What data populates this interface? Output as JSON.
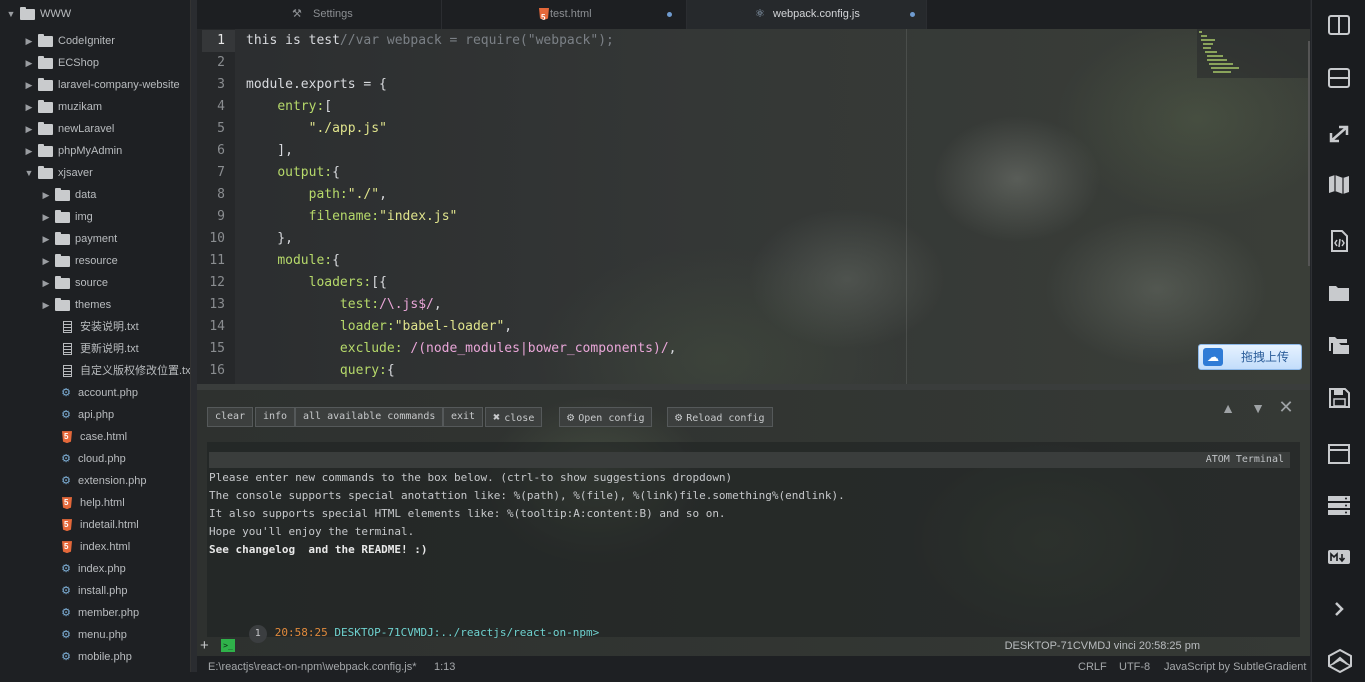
{
  "tree": {
    "root": "WWW",
    "items": [
      {
        "type": "folder",
        "label": "CodeIgniter",
        "depth": 1,
        "open": false
      },
      {
        "type": "folder",
        "label": "ECShop",
        "depth": 1,
        "open": false
      },
      {
        "type": "folder",
        "label": "laravel-company-website",
        "depth": 1,
        "open": false
      },
      {
        "type": "folder",
        "label": "muzikam",
        "depth": 1,
        "open": false
      },
      {
        "type": "folder",
        "label": "newLaravel",
        "depth": 1,
        "open": false
      },
      {
        "type": "folder",
        "label": "phpMyAdmin",
        "depth": 1,
        "open": false
      },
      {
        "type": "folder",
        "label": "xjsaver",
        "depth": 1,
        "open": true
      },
      {
        "type": "folder",
        "label": "data",
        "depth": 2,
        "open": false
      },
      {
        "type": "folder",
        "label": "img",
        "depth": 2,
        "open": false
      },
      {
        "type": "folder",
        "label": "payment",
        "depth": 2,
        "open": false
      },
      {
        "type": "folder",
        "label": "resource",
        "depth": 2,
        "open": false
      },
      {
        "type": "folder",
        "label": "source",
        "depth": 2,
        "open": false
      },
      {
        "type": "folder",
        "label": "themes",
        "depth": 2,
        "open": false
      },
      {
        "type": "txt",
        "label": "安装说明.txt",
        "depth": 2
      },
      {
        "type": "txt",
        "label": "更新说明.txt",
        "depth": 2
      },
      {
        "type": "txt",
        "label": "自定义版权修改位置.txt",
        "depth": 2
      },
      {
        "type": "php",
        "label": "account.php",
        "depth": 2
      },
      {
        "type": "php",
        "label": "api.php",
        "depth": 2
      },
      {
        "type": "html",
        "label": "case.html",
        "depth": 2
      },
      {
        "type": "php",
        "label": "cloud.php",
        "depth": 2
      },
      {
        "type": "php",
        "label": "extension.php",
        "depth": 2
      },
      {
        "type": "html",
        "label": "help.html",
        "depth": 2
      },
      {
        "type": "html",
        "label": "indetail.html",
        "depth": 2
      },
      {
        "type": "html",
        "label": "index.html",
        "depth": 2
      },
      {
        "type": "php",
        "label": "index.php",
        "depth": 2
      },
      {
        "type": "php",
        "label": "install.php",
        "depth": 2
      },
      {
        "type": "php",
        "label": "member.php",
        "depth": 2
      },
      {
        "type": "php",
        "label": "menu.php",
        "depth": 2
      },
      {
        "type": "php",
        "label": "mobile.php",
        "depth": 2
      }
    ]
  },
  "tabs": [
    {
      "label": "Settings",
      "icon": "tools-icon",
      "active": false,
      "modified": false
    },
    {
      "label": "test.html",
      "icon": "html5-icon",
      "active": false,
      "modified": true
    },
    {
      "label": "webpack.config.js",
      "icon": "atom-icon",
      "active": true,
      "modified": true
    }
  ],
  "editor": {
    "current_line": 1,
    "lines": [
      [
        [
          "pl",
          "this is test"
        ],
        [
          "cm",
          "//var webpack = require(\"webpack\");"
        ]
      ],
      [],
      [
        [
          "pl",
          "module.exports = {"
        ]
      ],
      [
        [
          "pl",
          "    "
        ],
        [
          "kw",
          "entry:"
        ],
        [
          "pl",
          "["
        ]
      ],
      [
        [
          "pl",
          "        "
        ],
        [
          "str",
          "\"./app.js\""
        ]
      ],
      [
        [
          "pl",
          "    ],"
        ]
      ],
      [
        [
          "pl",
          "    "
        ],
        [
          "kw",
          "output:"
        ],
        [
          "pl",
          "{"
        ]
      ],
      [
        [
          "pl",
          "        "
        ],
        [
          "kw",
          "path:"
        ],
        [
          "str",
          "\"./\""
        ],
        [
          "pl",
          ","
        ]
      ],
      [
        [
          "pl",
          "        "
        ],
        [
          "kw",
          "filename:"
        ],
        [
          "str",
          "\"index.js\""
        ]
      ],
      [
        [
          "pl",
          "    },"
        ]
      ],
      [
        [
          "pl",
          "    "
        ],
        [
          "kw",
          "module:"
        ],
        [
          "pl",
          "{"
        ]
      ],
      [
        [
          "pl",
          "        "
        ],
        [
          "kw",
          "loaders:"
        ],
        [
          "pl",
          "[{"
        ]
      ],
      [
        [
          "pl",
          "            "
        ],
        [
          "kw",
          "test:"
        ],
        [
          "rx",
          "/\\.js$/"
        ],
        [
          "pl",
          ","
        ]
      ],
      [
        [
          "pl",
          "            "
        ],
        [
          "kw",
          "loader:"
        ],
        [
          "str",
          "\"babel-loader\""
        ],
        [
          "pl",
          ","
        ]
      ],
      [
        [
          "pl",
          "            "
        ],
        [
          "kw",
          "exclude:"
        ],
        [
          "pl",
          " "
        ],
        [
          "rx",
          "/(node_modules|bower_components)/"
        ],
        [
          "pl",
          ","
        ]
      ],
      [
        [
          "pl",
          "            "
        ],
        [
          "kw",
          "query:"
        ],
        [
          "pl",
          "{"
        ]
      ]
    ]
  },
  "upload_button": {
    "label": "拖拽上传",
    "icon": "cloud-icon"
  },
  "terminal": {
    "buttons": [
      "clear",
      "info",
      "all available commands",
      "exit",
      "close"
    ],
    "open_config": "Open config",
    "reload_config": "Reload config",
    "header": "ATOM Terminal",
    "lines": [
      "Please enter new commands to the box below. (ctrl-to show suggestions dropdown)",
      "The console supports special anotattion like: %(path), %(file), %(link)file.something%(endlink).",
      "It also supports special HTML elements like: %(tooltip:A:content:B) and so on.",
      "Hope you'll enjoy the terminal.",
      "See changelog  and the README! :)"
    ],
    "prompt": {
      "num": "1",
      "time": "20:58:25",
      "host": "DESKTOP-71CVMDJ:",
      "path": "../reactjs/react-on-npm>"
    },
    "session_info": "DESKTOP-71CVMDJ vinci 20:58:25 pm"
  },
  "status": {
    "path": "E:\\reactjs\\react-on-npm\\webpack.config.js*",
    "position": "1:13",
    "line_ending": "CRLF",
    "encoding": "UTF-8",
    "grammar": "JavaScript by SubtleGradient"
  },
  "dock": [
    "split-vertical-icon",
    "split-horizontal-icon",
    "expand-icon",
    "map-icon",
    "code-file-icon",
    "folder-icon",
    "folders-icon",
    "save-icon",
    "window-icon",
    "list-icon",
    "markdown-icon",
    "chevron-right-icon",
    "atom-icon"
  ]
}
